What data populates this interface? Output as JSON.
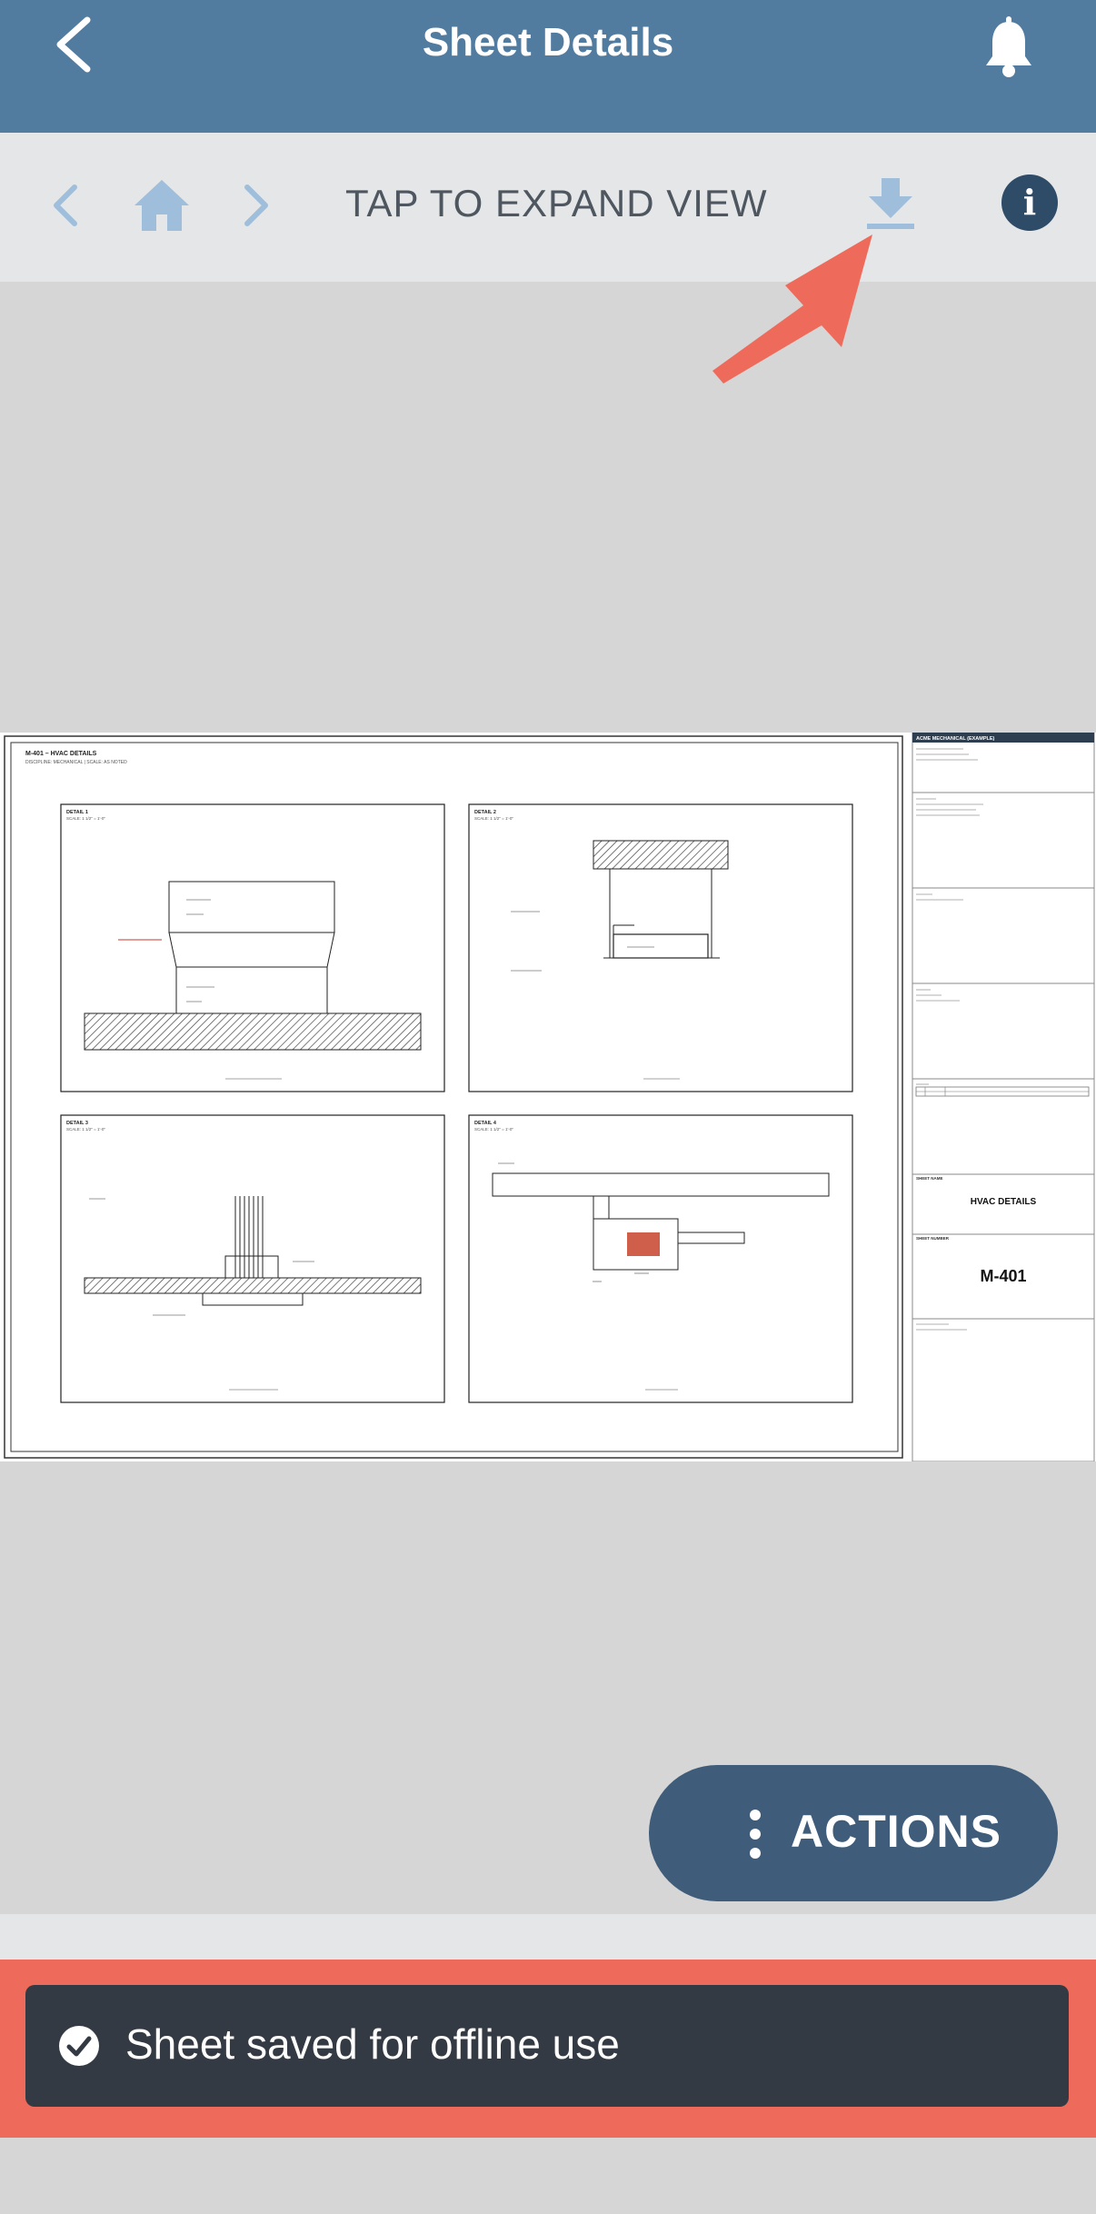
{
  "header": {
    "title": "Sheet Details"
  },
  "toolbar": {
    "expand_label": "TAP TO EXPAND VIEW",
    "info_glyph": "i"
  },
  "sheet": {
    "number": "M-401",
    "title": "HVAC DETAILS",
    "heading": "M-401 – HVAC DETAILS",
    "subheading": "DISCIPLINE: MECHANICAL | SCALE: AS NOTED",
    "details": [
      {
        "label": "DETAIL 1",
        "scale": "SCALE: 1 1/2\" = 1'-0\""
      },
      {
        "label": "DETAIL 2",
        "scale": "SCALE: 1 1/2\" = 1'-0\""
      },
      {
        "label": "DETAIL 3",
        "scale": "SCALE: 1 1/2\" = 1'-0\""
      },
      {
        "label": "DETAIL 4",
        "scale": "SCALE: 1 1/2\" = 1'-0\""
      }
    ],
    "titleblock": {
      "company": "ACME MECHANICAL (EXAMPLE)",
      "sheet_name_label": "SHEET NAME",
      "sheet_number_label": "SHEET NUMBER"
    }
  },
  "actions": {
    "label": "ACTIONS"
  },
  "toast": {
    "message": "Sheet saved for offline use"
  },
  "colors": {
    "header": "#527ba0",
    "toolbar": "#e5e6e7",
    "toolbar_icon": "#9fbedb",
    "info_button": "#2e4b68",
    "actions_button": "#3f5c7a",
    "toast": "#343a43",
    "highlight": "#ee6b5b",
    "background": "#d6d6d6"
  },
  "icons": [
    "back-chevron-icon",
    "bell-icon",
    "chevron-left-icon",
    "home-icon",
    "chevron-right-icon",
    "download-icon",
    "info-icon",
    "vertical-dots-icon",
    "check-circle-icon",
    "callout-arrow"
  ]
}
